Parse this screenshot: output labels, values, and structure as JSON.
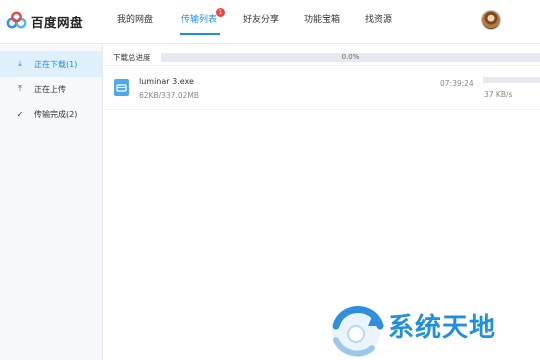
{
  "app": {
    "title": "百度网盘"
  },
  "nav": {
    "items": [
      {
        "label": "我的网盘"
      },
      {
        "label": "传输列表",
        "badge": "1"
      },
      {
        "label": "好友分享"
      },
      {
        "label": "功能宝箱"
      },
      {
        "label": "找资源"
      }
    ],
    "active_index": 1
  },
  "sidebar": {
    "items": [
      {
        "label": "正在下载(1)",
        "icon": "download-icon",
        "glyph": "⤓"
      },
      {
        "label": "正在上传",
        "icon": "upload-icon",
        "glyph": "⤒"
      },
      {
        "label": "传输完成(2)",
        "icon": "check-circle-icon",
        "glyph": "✓"
      }
    ],
    "active_index": 0
  },
  "progress": {
    "label": "下载总进度",
    "value_text": "0.0%",
    "fraction": 0.0
  },
  "downloads": [
    {
      "name": "luminar 3.exe",
      "size": "62KB/337.02MB",
      "time": "07:39:24",
      "speed": "37 KB/s",
      "fraction": 0.0002
    }
  ],
  "watermark": {
    "text": "系统天地"
  },
  "colors": {
    "accent": "#1d8ae8",
    "badge": "#f2453d",
    "sidebar_active_bg": "#dfeffc"
  }
}
